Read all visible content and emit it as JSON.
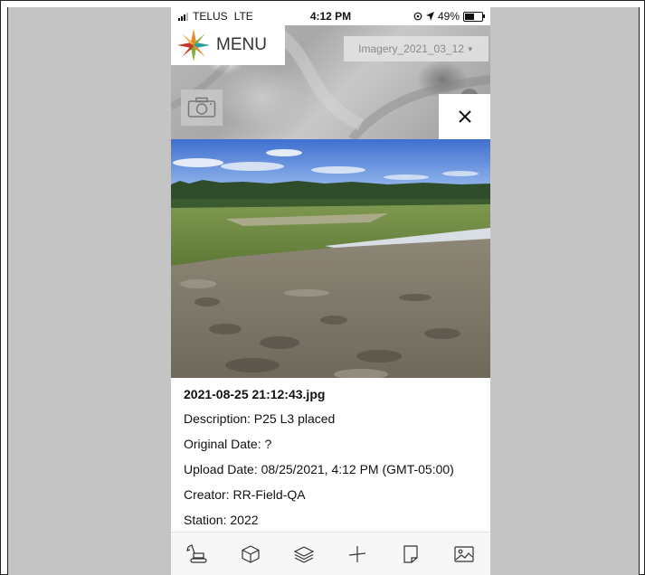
{
  "status_bar": {
    "carrier": "TELUS",
    "network": "LTE",
    "time": "4:12 PM",
    "battery": "49%"
  },
  "header": {
    "menu_label": "MENU",
    "imagery_selected": "Imagery_2021_03_12"
  },
  "photo": {
    "file_name": "2021-08-25 21:12:43.jpg",
    "description": "Description: P25 L3 placed",
    "original_date": "Original Date: ?",
    "upload_date": "Upload Date: 08/25/2021, 4:12 PM (GMT-05:00)",
    "creator": "Creator: RR-Field-QA",
    "station": "Station: 2022"
  },
  "toolbar": {
    "items": [
      {
        "icon": "excavator-icon"
      },
      {
        "icon": "cube-icon"
      },
      {
        "icon": "layers-icon"
      },
      {
        "icon": "crosshair-icon"
      },
      {
        "icon": "note-icon"
      },
      {
        "icon": "image-icon"
      }
    ]
  },
  "colors": {
    "accent_orange": "#e8892a",
    "accent_green": "#7fae3a",
    "accent_red": "#c0392b",
    "accent_teal": "#2a9aa0"
  }
}
